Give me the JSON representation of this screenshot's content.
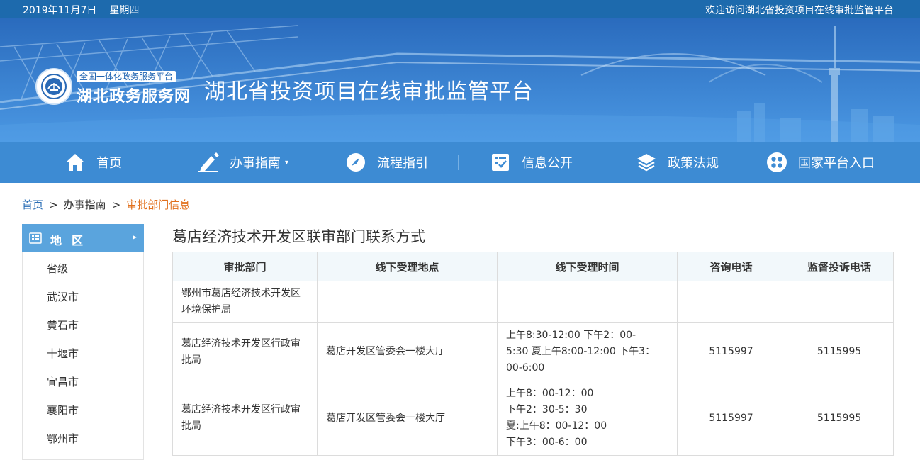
{
  "topbar": {
    "date": "2019年11月7日",
    "weekday": "星期四",
    "welcome": "欢迎访问湖北省投资项目在线审批监管平台"
  },
  "header": {
    "logo_tag": "全国一体化政务服务平台",
    "logo_name": "湖北政务服务网",
    "site_title": "湖北省投资项目在线审批监管平台"
  },
  "nav": {
    "items": [
      {
        "label": "首页",
        "icon": "home-icon"
      },
      {
        "label": "办事指南",
        "icon": "pen-icon"
      },
      {
        "label": "流程指引",
        "icon": "compass-icon"
      },
      {
        "label": "信息公开",
        "icon": "checklist-icon"
      },
      {
        "label": "政策法规",
        "icon": "layers-icon"
      },
      {
        "label": "国家平台入口",
        "icon": "grid-circle-icon"
      }
    ],
    "dropdown_caret": "▾"
  },
  "breadcrumb": {
    "home": "首页",
    "guide": "办事指南",
    "current": "审批部门信息",
    "separator": ">"
  },
  "sidebar": {
    "heading": "地区",
    "items": [
      "省级",
      "武汉市",
      "黄石市",
      "十堰市",
      "宜昌市",
      "襄阳市",
      "鄂州市"
    ]
  },
  "content": {
    "title": "葛店经济技术开发区联审部门联系方式",
    "columns": [
      "审批部门",
      "线下受理地点",
      "线下受理时间",
      "咨询电话",
      "监督投诉电话"
    ],
    "rows": [
      {
        "department": "鄂州市葛店经济技术开发区环境保护局",
        "location": "",
        "hours": [],
        "consult_phone": "",
        "complaint_phone": ""
      },
      {
        "department": "葛店经济技术开发区行政审批局",
        "location": "葛店开发区管委会一楼大厅",
        "hours": [
          "上午8:30-12:00 下午2：00-",
          "5:30 夏上午8:00-12:00 下午3：",
          "00-6:00"
        ],
        "consult_phone": "5115997",
        "complaint_phone": "5115995"
      },
      {
        "department": "葛店经济技术开发区行政审批局",
        "location": "葛店开发区管委会一楼大厅",
        "hours": [
          "上午8：00-12：00",
          "下午2：30-5：30",
          "夏:上午8：00-12：00",
          "下午3：00-6：00"
        ],
        "consult_phone": "5115997",
        "complaint_phone": "5115995"
      }
    ]
  },
  "colors": {
    "topbar": "#1d6aad",
    "nav": "#3d8bd3",
    "sidebar_head": "#5aa4dd",
    "breadcrumb_current": "#e1701d",
    "link": "#2a6eb5"
  }
}
